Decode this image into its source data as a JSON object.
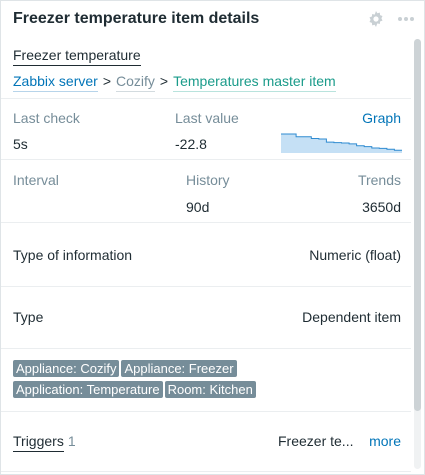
{
  "widget": {
    "title": "Freezer temperature item details"
  },
  "item": {
    "name": "Freezer temperature",
    "breadcrumb": [
      "Zabbix server",
      "Cozify",
      "Temperatures master item"
    ],
    "separator": ">"
  },
  "metrics": {
    "last_check_label": "Last check",
    "last_check_value": "5s",
    "last_value_label": "Last value",
    "last_value_value": "-22.8",
    "graph_link": "Graph",
    "sparkline": [
      1.0,
      1.0,
      0.85,
      0.85,
      0.75,
      0.72,
      0.55,
      0.52,
      0.5,
      0.45,
      0.35,
      0.3,
      0.22,
      0.2,
      0.15,
      0.1
    ]
  },
  "storage": {
    "interval_label": "Interval",
    "history_label": "History",
    "history_value": "90d",
    "trends_label": "Trends",
    "trends_value": "3650d"
  },
  "info": {
    "type_info_label": "Type of information",
    "type_info_value": "Numeric (float)",
    "type_label": "Type",
    "type_value": "Dependent item"
  },
  "tags": [
    "Appliance: Cozify",
    "Appliance: Freezer",
    "Application: Temperature",
    "Room: Kitchen"
  ],
  "triggers": {
    "label": "Triggers",
    "count": "1",
    "name": "Freezer te...",
    "more": "more"
  },
  "colors": {
    "link": "#0275b8",
    "tag_bg": "#768d99",
    "sparkline_fill": "#c5e0f5",
    "sparkline_line": "#2f8bd1"
  }
}
